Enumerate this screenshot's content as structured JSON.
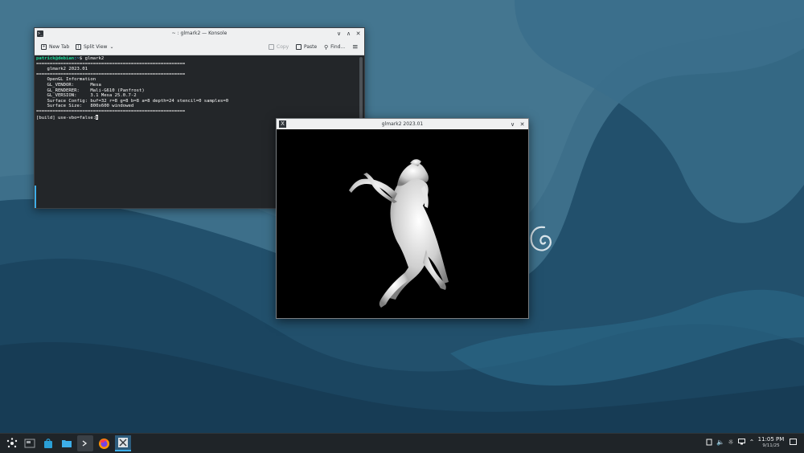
{
  "konsole": {
    "title": "~ : glmark2 — Konsole",
    "toolbar": {
      "new_tab": "New Tab",
      "split_view": "Split View",
      "copy": "Copy",
      "paste": "Paste",
      "find": "Find..."
    },
    "terminal": {
      "prompt_user": "patrick@debian",
      "prompt_path": ":~",
      "prompt_cmd": "$ glmark2",
      "sep": "=======================================================",
      "banner": "    glmark2 2023.01",
      "info_lines": [
        "    OpenGL Information",
        "    GL_VENDOR:      Mesa",
        "    GL_RENDERER:    Mali-G610 (Panfrost)",
        "    GL_VERSION:     3.1 Mesa 25.0.7-2",
        "    Surface Config: buf=32 r=8 g=8 b=8 a=8 depth=24 stencil=0 samples=0",
        "    Surface Size:   800x600 windowed"
      ],
      "current_line": "[build] use-vbo=false:"
    }
  },
  "glmark": {
    "title": "glmark2 2023.01",
    "app_icon_glyph": "X"
  },
  "taskbar": {
    "clock_time": "11:05 PM",
    "clock_date": "9/11/25"
  },
  "colors": {
    "wallpaper_dark": "#1e4660",
    "wallpaper_light": "#2f6b8c",
    "terminal_bg": "#232629",
    "prompt_green": "#1cdc9a",
    "accent_blue": "#3daee9"
  }
}
